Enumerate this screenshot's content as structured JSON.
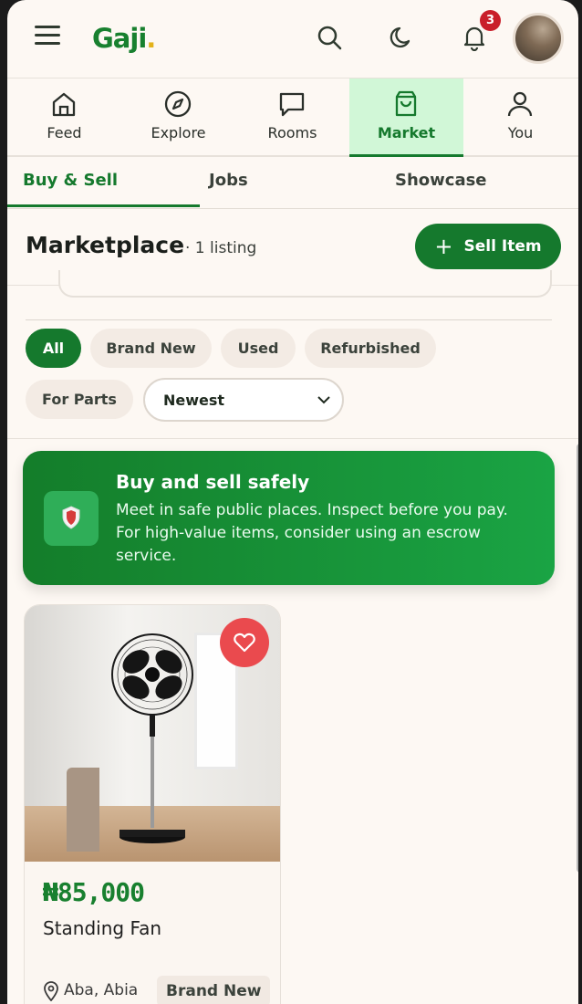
{
  "header": {
    "logo_text": "Gaji",
    "logo_dot": ".",
    "notification_count": "3",
    "icons": [
      "menu-icon",
      "search-icon",
      "moon-icon",
      "bell-icon"
    ]
  },
  "nav": {
    "items": [
      {
        "label": "Feed",
        "icon": "home-icon"
      },
      {
        "label": "Explore",
        "icon": "compass-icon"
      },
      {
        "label": "Rooms",
        "icon": "chat-icon"
      },
      {
        "label": "Market",
        "icon": "shopping-bag-icon",
        "active": true
      },
      {
        "label": "You",
        "icon": "user-icon"
      }
    ]
  },
  "subtabs": [
    "Buy & Sell",
    "Jobs",
    "Showcase"
  ],
  "marketplace": {
    "title": "Marketplace",
    "count": "· 1 listing",
    "sell_label": "Sell Item",
    "sell_plus": "+"
  },
  "filters": {
    "chips": [
      "All",
      "Brand New",
      "Used",
      "Refurbished",
      "For Parts"
    ],
    "sort_value": "Newest"
  },
  "banner": {
    "title": "Buy and sell safely",
    "text": "Meet in safe public places. Inspect before you pay. For high-value items, consider using an escrow service."
  },
  "listing": {
    "price": "₦85,000",
    "name": "Standing Fan",
    "location": "Aba, Abia",
    "condition": "Brand New"
  },
  "colors": {
    "brand": "#15792d",
    "accent_dot": "#e3b21a",
    "badge": "#c91f2a",
    "heart": "#ea4a4e",
    "active_nav_bg": "#d1f7d7"
  }
}
